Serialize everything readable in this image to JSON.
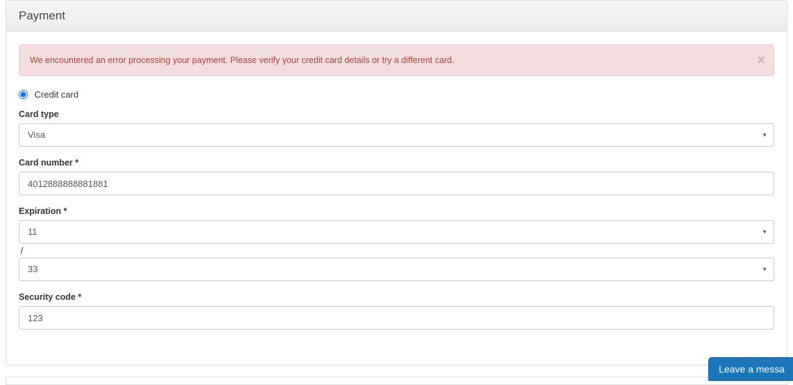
{
  "panel": {
    "title": "Payment"
  },
  "alert": {
    "message": "We encountered an error processing your payment. Please verify your credit card details or try a different card.",
    "close_glyph": "×"
  },
  "payment_method": {
    "credit_card_label": "Credit card",
    "selected": true
  },
  "fields": {
    "card_type": {
      "label": "Card type",
      "value": "Visa"
    },
    "card_number": {
      "label": "Card number *",
      "value": "4012888888881881"
    },
    "expiration": {
      "label": "Expiration *",
      "month": "11",
      "separator": "/",
      "year": "33"
    },
    "security_code": {
      "label": "Security code *",
      "value": "123"
    }
  },
  "chat": {
    "label": "Leave a messa"
  }
}
